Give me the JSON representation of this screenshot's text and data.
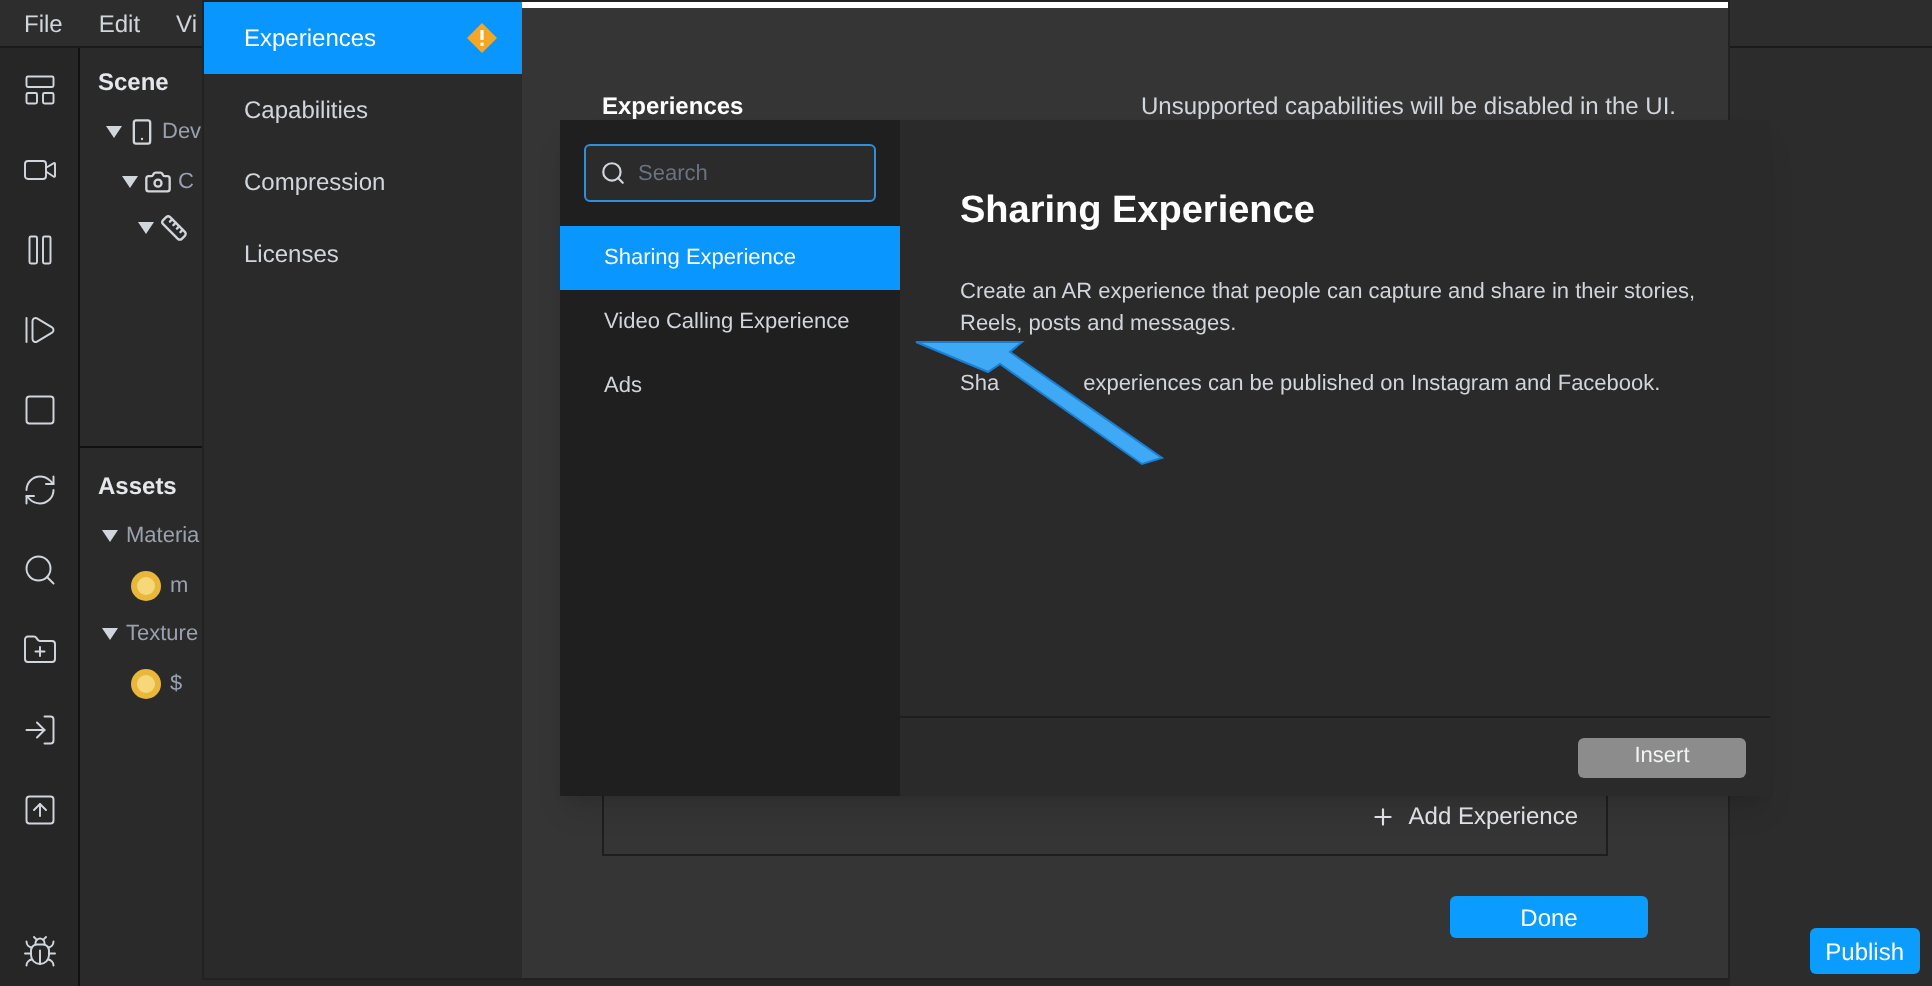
{
  "menu_bar": [
    "File",
    "Edit",
    "Vi"
  ],
  "scene_panel": {
    "title": "Scene",
    "items": [
      {
        "kind": "device",
        "label": "Dev"
      },
      {
        "kind": "camera",
        "label": "C"
      },
      {
        "kind": "ruler"
      }
    ]
  },
  "assets_panel": {
    "title": "Assets",
    "groups": [
      {
        "label": "Materia",
        "children": [
          {
            "label": "m"
          }
        ]
      },
      {
        "label": "Texture",
        "children": [
          {
            "label": "$"
          }
        ]
      }
    ]
  },
  "publish_button": "Publish",
  "project_dialog": {
    "tabs": [
      {
        "label": "Experiences",
        "selected": true,
        "warning": true
      },
      {
        "label": "Capabilities",
        "selected": false,
        "warning": false
      },
      {
        "label": "Compression",
        "selected": false,
        "warning": false
      },
      {
        "label": "Licenses",
        "selected": false,
        "warning": false
      }
    ],
    "section_title": "Experiences",
    "note": "Unsupported capabilities will be disabled in the UI.",
    "add_button": "Add Experience",
    "done_button": "Done"
  },
  "experience_picker": {
    "search": {
      "placeholder": "Search"
    },
    "items": [
      {
        "label": "Sharing Experience",
        "selected": true
      },
      {
        "label": "Video Calling Experience",
        "selected": false
      },
      {
        "label": "Ads",
        "selected": false
      }
    ],
    "detail_title": "Sharing Experience",
    "paragraphs": [
      "Create an AR experience that people can capture and share in their stories, Reels, posts and messages."
    ],
    "covered_line": [
      "Sha",
      "experiences can be published on Instagram and Facebook."
    ],
    "insert_button": "Insert"
  }
}
